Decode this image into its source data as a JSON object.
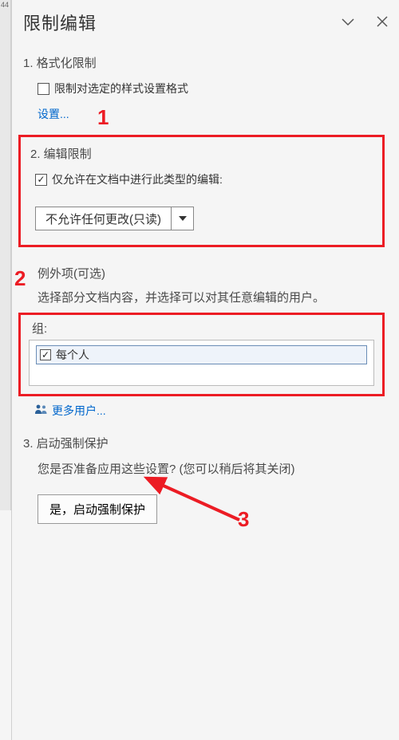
{
  "left_gutter": {
    "lineno": "44"
  },
  "header": {
    "title": "限制编辑"
  },
  "section1": {
    "heading": "1. 格式化限制",
    "checkbox_label": "限制对选定的样式设置格式",
    "settings_link": "设置..."
  },
  "section2": {
    "heading": "2. 编辑限制",
    "checkbox_label": "仅允许在文档中进行此类型的编辑:",
    "dropdown_value": "不允许任何更改(只读)"
  },
  "exceptions": {
    "heading": "例外项(可选)",
    "desc": "选择部分文档内容，并选择可以对其任意编辑的用户。",
    "groups_label": "组:",
    "everyone": "每个人",
    "more_users": "更多用户..."
  },
  "section3": {
    "heading": "3. 启动强制保护",
    "desc": "您是否准备应用这些设置? (您可以稍后将其关闭)",
    "button": "是，启动强制保护"
  },
  "annotations": {
    "one": "1",
    "two": "2",
    "three": "3"
  }
}
